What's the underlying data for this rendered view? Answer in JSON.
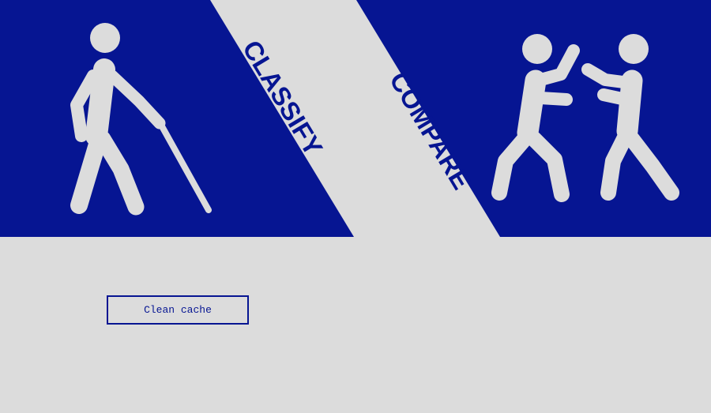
{
  "panels": [
    {
      "label": "CLASSIFY",
      "icon": "blind-person-with-cane-icon"
    },
    {
      "label": "COMPARE",
      "icon": "two-people-boxing-icon"
    }
  ],
  "actions": {
    "clean_cache_label": "Clean cache"
  },
  "colors": {
    "panel_blue": "#061592",
    "background_grey": "#dcdcdc",
    "figure_grey": "#dcdcdc"
  }
}
